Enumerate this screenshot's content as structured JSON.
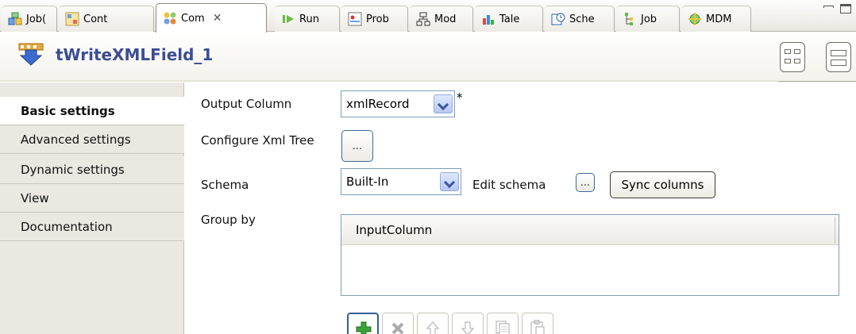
{
  "tabs": [
    {
      "label": "Job(",
      "icon": "job-icon",
      "active": false
    },
    {
      "label": "Cont",
      "icon": "context-icon",
      "active": false
    },
    {
      "label": "Com",
      "icon": "component-icon",
      "active": true
    },
    {
      "label": "Run",
      "icon": "run-icon",
      "active": false
    },
    {
      "label": "Prob",
      "icon": "problems-icon",
      "active": false
    },
    {
      "label": "Mod",
      "icon": "modules-icon",
      "active": false
    },
    {
      "label": "Tale",
      "icon": "talend-icon",
      "active": false
    },
    {
      "label": "Sche",
      "icon": "scheduler-icon",
      "active": false
    },
    {
      "label": "Job",
      "icon": "job-hierarchy-icon",
      "active": false
    },
    {
      "label": "MDM",
      "icon": "mdm-icon",
      "active": false
    }
  ],
  "component": {
    "title": "tWriteXMLField_1",
    "icon": "twritexmlfield-icon"
  },
  "sidebar": {
    "items": [
      {
        "label": "Basic settings",
        "active": true
      },
      {
        "label": "Advanced settings",
        "active": false
      },
      {
        "label": "Dynamic settings",
        "active": false
      },
      {
        "label": "View",
        "active": false
      },
      {
        "label": "Documentation",
        "active": false
      }
    ]
  },
  "form": {
    "output_column_label": "Output Column",
    "output_column_value": "xmlRecord",
    "required_marker": "*",
    "configure_xml_tree_label": "Configure Xml Tree",
    "configure_button": "...",
    "schema_label": "Schema",
    "schema_value": "Built-In",
    "edit_schema_label": "Edit schema",
    "edit_schema_button": "...",
    "sync_columns_label": "Sync columns",
    "group_by_label": "Group by",
    "group_by_table": {
      "columns": [
        "InputColumn"
      ],
      "rows": []
    }
  },
  "toolbar_buttons": [
    {
      "icon": "add-icon",
      "enabled": true
    },
    {
      "icon": "remove-icon",
      "enabled": false
    },
    {
      "icon": "move-up-icon",
      "enabled": false
    },
    {
      "icon": "move-down-icon",
      "enabled": false
    },
    {
      "icon": "copy-icon",
      "enabled": false
    },
    {
      "icon": "paste-icon",
      "enabled": false
    }
  ],
  "colors": {
    "title": "#3c4c96",
    "accent": "#335f98",
    "add_green": "#3aa23a"
  }
}
